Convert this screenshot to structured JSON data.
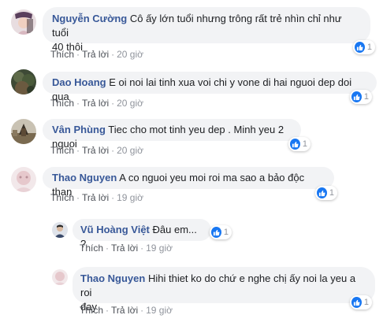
{
  "actions": {
    "like": "Thích",
    "reply": "Trả lời",
    "separator": "·"
  },
  "comments": [
    {
      "name": "Nguyễn Cường",
      "text_line1": "Cô ấy lớn tuổi nhưng trông rất trẻ nhìn chỉ như tuổi",
      "text_line2": "40 thôi",
      "time": "20 giờ",
      "reactions": "1"
    },
    {
      "name": "Dao Hoang",
      "text": "E oi noi lai tinh xua voi chi y vone di hai nguoi dep doi qua",
      "time": "20 giờ",
      "reactions": "1"
    },
    {
      "name": "Vân Phùng",
      "text": "Tiec cho mot tinh yeu dep . Minh yeu 2 nguoi",
      "time": "20 giờ",
      "reactions": "1"
    },
    {
      "name": "Thao Nguyen",
      "text": "A co nguoi yeu moi roi ma sao a bảo độc than",
      "time": "19 giờ",
      "reactions": "1"
    }
  ],
  "replies": [
    {
      "name": "Vũ Hoàng Việt",
      "text": "Đâu em... ?",
      "time": "19 giờ",
      "reactions": "1"
    },
    {
      "name": "Thao Nguyen",
      "text_line1": "Hihi thiet ko do chứ e nghe chị ấy noi la yeu a roi",
      "text_line2": "đay",
      "time": "19 giờ",
      "reactions": "1"
    }
  ],
  "colors": {
    "name": "#385898",
    "bubble": "#f2f3f5",
    "like": "#1877f2",
    "meta": "#90949c"
  },
  "icons": {
    "reaction": "thumbs-up-icon"
  }
}
